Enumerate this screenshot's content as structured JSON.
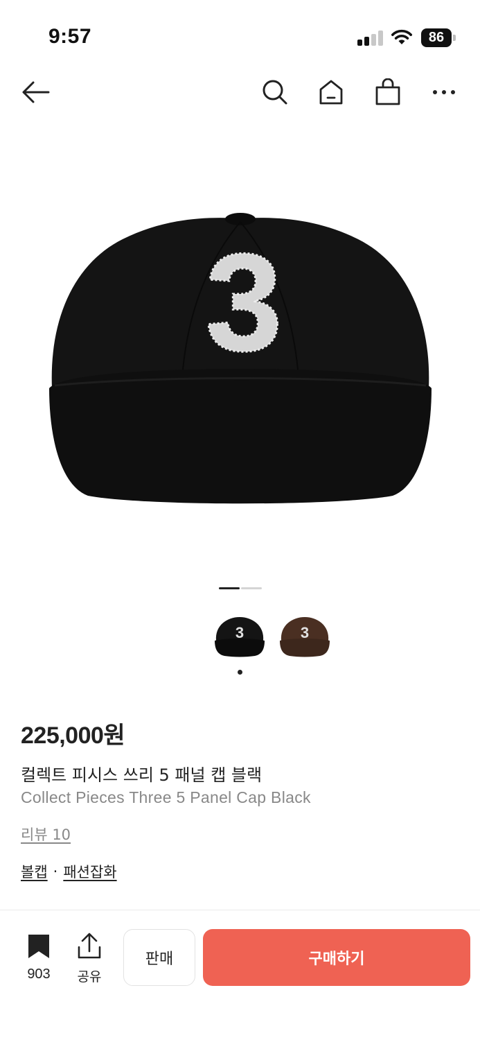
{
  "status": {
    "time": "9:57",
    "battery": "86"
  },
  "nav": {
    "back_icon": "arrow-left-icon",
    "search_icon": "search-icon",
    "home_icon": "home-icon",
    "cart_icon": "shopping-bag-icon",
    "more_icon": "more-horizontal-icon"
  },
  "product": {
    "image_number": "3",
    "variants": [
      {
        "number": "3",
        "color": "#141414"
      },
      {
        "number": "3",
        "color": "#4a2f22"
      }
    ],
    "image_page": {
      "current": 1,
      "total": 2
    },
    "price": "225,000원",
    "name_ko": "컬렉트 피시스 쓰리 5 패널 캡 블랙",
    "name_en": "Collect Pieces Three 5 Panel Cap Black",
    "review": "리뷰 10",
    "categories": [
      "볼캡",
      "패션잡화"
    ],
    "category_separator": "·"
  },
  "bottom_bar": {
    "bookmark_count": "903",
    "share_label": "공유",
    "sell_label": "판매",
    "buy_label": "구매하기"
  },
  "colors": {
    "accent": "#ef6253",
    "text_primary": "#222222",
    "text_secondary": "#888888"
  }
}
